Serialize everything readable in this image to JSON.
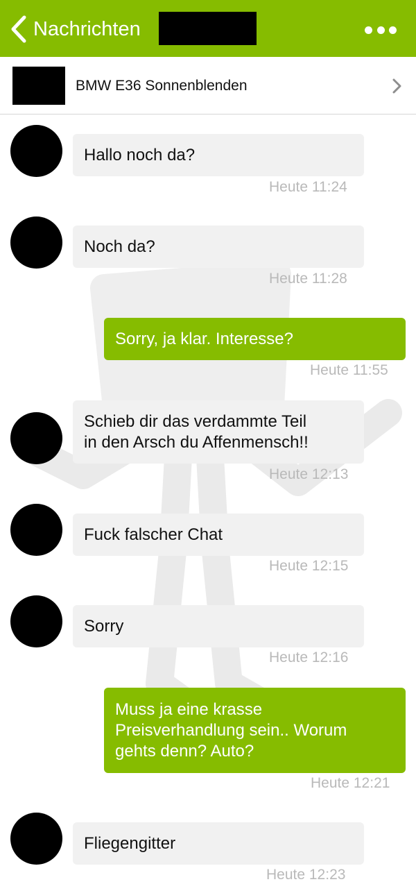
{
  "header": {
    "back_label": "Nachrichten",
    "accent_color": "#86bc00",
    "more_icon": "more-horizontal-icon"
  },
  "listing": {
    "title": "BMW E36 Sonnenblenden",
    "chevron_icon": "chevron-right-icon"
  },
  "messages": [
    {
      "direction": "incoming",
      "text": "Hallo noch da?",
      "time": "Heute 11:24"
    },
    {
      "direction": "incoming",
      "text": "Noch da?",
      "time": "Heute 11:28"
    },
    {
      "direction": "outgoing",
      "text": "Sorry, ja klar. Interesse?",
      "time": "Heute 11:55"
    },
    {
      "direction": "incoming",
      "text": "Schieb dir das verdammte Teil\nin den Arsch du Affenmensch!!",
      "time": "Heute 12:13"
    },
    {
      "direction": "incoming",
      "text": "Fuck falscher Chat",
      "time": "Heute 12:15"
    },
    {
      "direction": "incoming",
      "text": "Sorry",
      "time": "Heute 12:16"
    },
    {
      "direction": "outgoing",
      "text": "Muss ja eine krasse\nPreisverhandlung sein.. Worum\ngehts denn? Auto?",
      "time": "Heute 12:21"
    },
    {
      "direction": "incoming",
      "text": "Fliegengitter",
      "time": "Heute 12:23"
    }
  ]
}
